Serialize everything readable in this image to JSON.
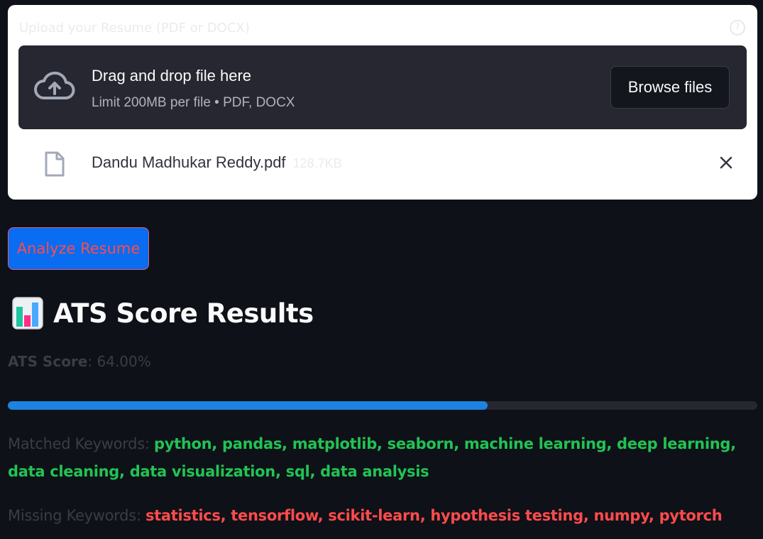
{
  "uploader": {
    "label": "Upload your Resume (PDF or DOCX)",
    "help_icon": "?",
    "dropzone_title": "Drag and drop file here",
    "dropzone_sub": "Limit 200MB per file • PDF, DOCX",
    "browse_label": "Browse files",
    "file_name": "Dandu Madhukar Reddy.pdf",
    "file_size": "128.7KB"
  },
  "actions": {
    "analyze_label": "Analyze Resume"
  },
  "results": {
    "title": "ATS Score Results",
    "score_label": "ATS Score",
    "score_text": ": 64.00%",
    "score_fraction": 0.64,
    "matched_label": "Matched Keywords: ",
    "matched": "python, pandas, matplotlib, seaborn, machine learning, deep learning, data cleaning, data visualization, sql, data analysis",
    "missing_label": "Missing Keywords: ",
    "missing": "statistics, tensorflow, scikit-learn, hypothesis testing, numpy, pytorch"
  },
  "icons": {
    "upload": "cloud-upload-icon",
    "file": "file-icon",
    "remove": "close-icon",
    "chart": "bar-chart-icon",
    "help": "help-icon"
  },
  "colors": {
    "background": "#0e1117",
    "primary_button": "#0a6cf0",
    "accent_red": "#ff4b4b",
    "progress": "#1c83e1",
    "matched": "#21c354",
    "missing": "#ff4b4b"
  }
}
